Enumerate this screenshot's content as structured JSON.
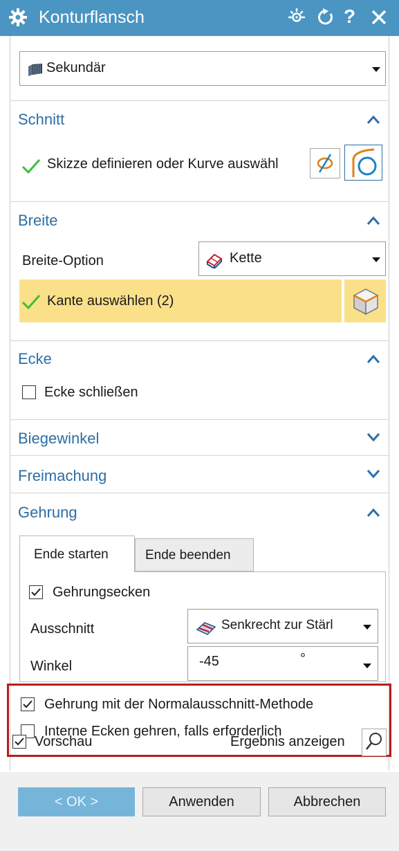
{
  "window": {
    "title": "Konturflansch"
  },
  "type_selector": {
    "value": "Sekundär"
  },
  "sections": {
    "schnitt": {
      "title": "Schnitt",
      "selection_label": "Skizze definieren oder Kurve auswähl"
    },
    "breite": {
      "title": "Breite",
      "option_label": "Breite-Option",
      "option_value": "Kette",
      "selection_label": "Kante auswählen (2)"
    },
    "ecke": {
      "title": "Ecke",
      "close_corner_label": "Ecke schließen",
      "close_corner_checked": false
    },
    "biegewinkel": {
      "title": "Biegewinkel"
    },
    "freimachung": {
      "title": "Freimachung"
    },
    "gehrung": {
      "title": "Gehrung",
      "tabs": [
        "Ende starten",
        "Ende beenden"
      ],
      "active_tab": 0,
      "miter_corners_label": "Gehrungsecken",
      "miter_corners_checked": true,
      "cutout_label": "Ausschnitt",
      "cutout_value": "Senkrecht zur Stärl",
      "angle_label": "Winkel",
      "angle_value": "-45",
      "angle_unit": "°",
      "normal_cutout_label": "Gehrung mit der Normalausschnitt-Methode",
      "normal_cutout_checked": true,
      "internal_corners_label": "Interne Ecken gehren, falls erforderlich",
      "internal_corners_checked": false
    }
  },
  "footer": {
    "preview_label": "Vorschau",
    "preview_checked": true,
    "show_result_label": "Ergebnis anzeigen",
    "ok_label": "< OK >",
    "apply_label": "Anwenden",
    "cancel_label": "Abbrechen"
  },
  "colors": {
    "titlebar": "#4a95c2",
    "section_header": "#2d6ea6",
    "highlight_row": "#fbe08a",
    "checkmark": "#3dbb3d",
    "annotation_border": "#b71c1c",
    "ok_button": "#76b5da"
  }
}
